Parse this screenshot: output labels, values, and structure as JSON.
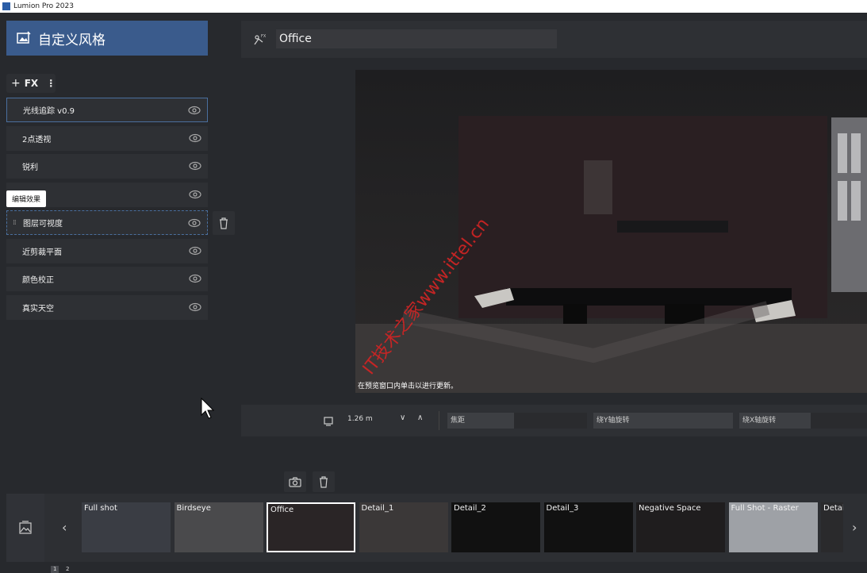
{
  "window": {
    "title": "Lumion Pro 2023"
  },
  "panel": {
    "title": "自定义风格",
    "fx_button": "FX",
    "items": [
      {
        "label": "光线追踪 v0.9"
      },
      {
        "label": "2点透视"
      },
      {
        "label": "锐利"
      },
      {
        "label": ""
      },
      {
        "label": "图层可视度"
      },
      {
        "label": "近剪裁平面"
      },
      {
        "label": "颜色校正"
      },
      {
        "label": "真实天空"
      }
    ],
    "tooltip": "编辑效果"
  },
  "view": {
    "title": "Office",
    "preview_hint": "在预览窗口内单击以进行更新。",
    "watermark": "IT技术之家www.ittel.cn"
  },
  "toolbar": {
    "distance": "1.26 m",
    "fields": [
      "焦距",
      "绕Y轴旋转",
      "绕X轴旋转"
    ]
  },
  "filmstrip": {
    "thumbs": [
      {
        "label": "Full shot"
      },
      {
        "label": "Birdseye"
      },
      {
        "label": "Office"
      },
      {
        "label": "Detail_1"
      },
      {
        "label": "Detail_2"
      },
      {
        "label": "Detail_3"
      },
      {
        "label": "Negative Space"
      },
      {
        "label": "Full Shot - Raster"
      },
      {
        "label": "Detai"
      }
    ],
    "pages": [
      "1",
      "2"
    ]
  },
  "colors": {
    "accent": "#3a5b8c",
    "background": "#27292d",
    "panel": "#2e3034"
  }
}
